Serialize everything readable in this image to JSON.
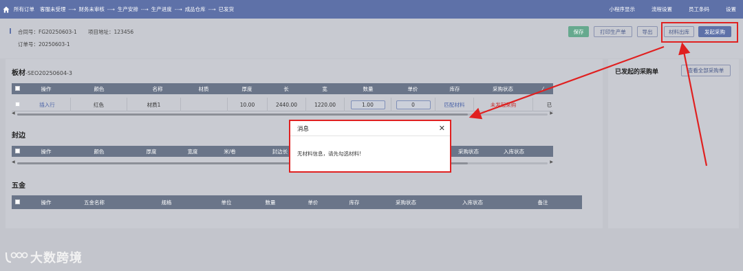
{
  "nav": {
    "crumbs": [
      "所有订单",
      "客服未受理",
      "财务未审核",
      "生产安排",
      "生产进度",
      "成品仓库",
      "已发货"
    ],
    "right_links": [
      "小程序显示",
      "流程设置",
      "员工条码",
      "设置"
    ]
  },
  "order": {
    "contract_label": "合同号：FG20250603-1",
    "project_label": "项目地址：123456",
    "order_label": "订单号：20250603-1"
  },
  "toolbar": {
    "save": "保存",
    "print": "打印生产单",
    "export": "导出",
    "material_out": "材料出库",
    "start_purchase": "发起采购"
  },
  "board": {
    "title": "板材",
    "code": "-SEO20250604-3",
    "headers": [
      "操作",
      "颜色",
      "名称",
      "材质",
      "厚度",
      "长",
      "宽",
      "数量",
      "单价",
      "库存",
      "采购状态"
    ],
    "row": {
      "action": "插入行",
      "color": "红色",
      "name": "材质1",
      "material": "",
      "thickness": "10.00",
      "length": "2440.00",
      "width": "1220.00",
      "quantity": "1.00",
      "price": "0",
      "stock": "匹配材料",
      "purchase_status": "未发起采购",
      "extra": "已"
    }
  },
  "edge": {
    "title": "封边",
    "headers": [
      "操作",
      "颜色",
      "厚度",
      "宽度",
      "米/卷",
      "封边长",
      "采购状态",
      "入库状态"
    ]
  },
  "hardware": {
    "title": "五金",
    "headers": [
      "操作",
      "五金名称",
      "规格",
      "单位",
      "数量",
      "单价",
      "库存",
      "采购状态",
      "入库状态",
      "备注"
    ]
  },
  "side": {
    "title": "已发起的采购单",
    "view_all": "查看全部采购单"
  },
  "dialog": {
    "title": "消息",
    "message": "无材料信息，请先勾选材料!"
  },
  "watermark": "大数跨境",
  "colors": {
    "nav_bg": "#5e71a8",
    "table_header": "#6a7589",
    "save_button": "#66a98e",
    "highlight": "#e02020"
  }
}
